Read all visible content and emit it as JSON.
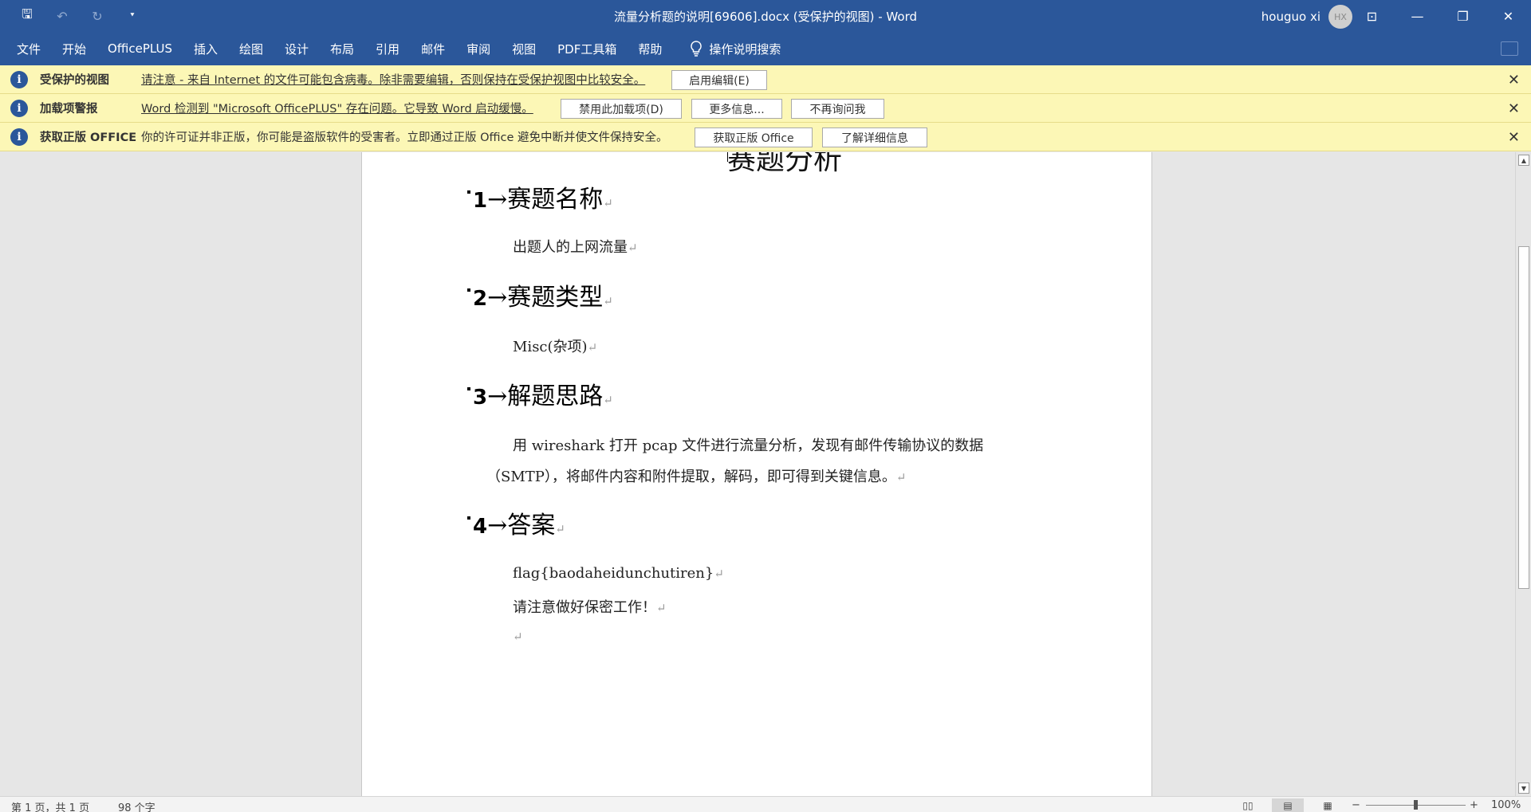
{
  "window": {
    "title": "流量分析题的说明[69606].docx (受保护的视图)  -  Word",
    "user_name": "houguo xi",
    "avatar_initials": "HX",
    "quick_access": [
      {
        "name": "save-icon",
        "glyph": "🖫"
      },
      {
        "name": "undo-icon",
        "glyph": "↶"
      },
      {
        "name": "redo-icon",
        "glyph": "↻"
      },
      {
        "name": "customize-qat-icon",
        "glyph": "⯆"
      }
    ],
    "controls": {
      "ribbon_display": "⊡",
      "minimize": "—",
      "restore": "❐",
      "close": "✕"
    }
  },
  "ribbon": {
    "tabs": [
      "文件",
      "开始",
      "OfficePLUS",
      "插入",
      "绘图",
      "设计",
      "布局",
      "引用",
      "邮件",
      "审阅",
      "视图",
      "PDF工具箱",
      "帮助"
    ],
    "search_label": "操作说明搜索"
  },
  "message_bars": [
    {
      "title": "受保护的视图",
      "text": "请注意 - 来自 Internet 的文件可能包含病毒。除非需要编辑，否则保持在受保护视图中比较安全。",
      "buttons": [
        "启用编辑(E)"
      ]
    },
    {
      "title": "加载项警报",
      "text": "Word 检测到 \"Microsoft OfficePLUS\" 存在问题。它导致 Word 启动缓慢。",
      "buttons": [
        "禁用此加载项(D)",
        "更多信息...",
        "不再询问我"
      ]
    },
    {
      "title": "获取正版 OFFICE",
      "text": "你的许可证并非正版，你可能是盗版软件的受害者。立即通过正版 Office 避免中断并使文件保持安全。",
      "buttons": [
        "获取正版 Office",
        "了解详细信息"
      ]
    }
  ],
  "document": {
    "cut_title": "赛题分析",
    "sections": [
      {
        "num": "1",
        "heading": "赛题名称",
        "body": [
          "出题人的上网流量"
        ]
      },
      {
        "num": "2",
        "heading": "赛题类型",
        "body": [
          "Misc(杂项)"
        ]
      },
      {
        "num": "3",
        "heading": "解题思路",
        "body": [
          "用  wireshark  打开  pcap  文件进行流量分析，发现有邮件传输协议的数据",
          "（SMTP），将邮件内容和附件提取，解码，即可得到关键信息。"
        ]
      },
      {
        "num": "4",
        "heading": "答案",
        "body": [
          "flag{baodaheidunchutiren}",
          "请注意做好保密工作！"
        ]
      }
    ],
    "return_mark": "↵",
    "arrow": "→"
  },
  "status": {
    "page": "第 1 页，共 1 页",
    "words": "98 个字",
    "zoom": "100%",
    "zoom_minus": "−",
    "zoom_plus": "+"
  }
}
